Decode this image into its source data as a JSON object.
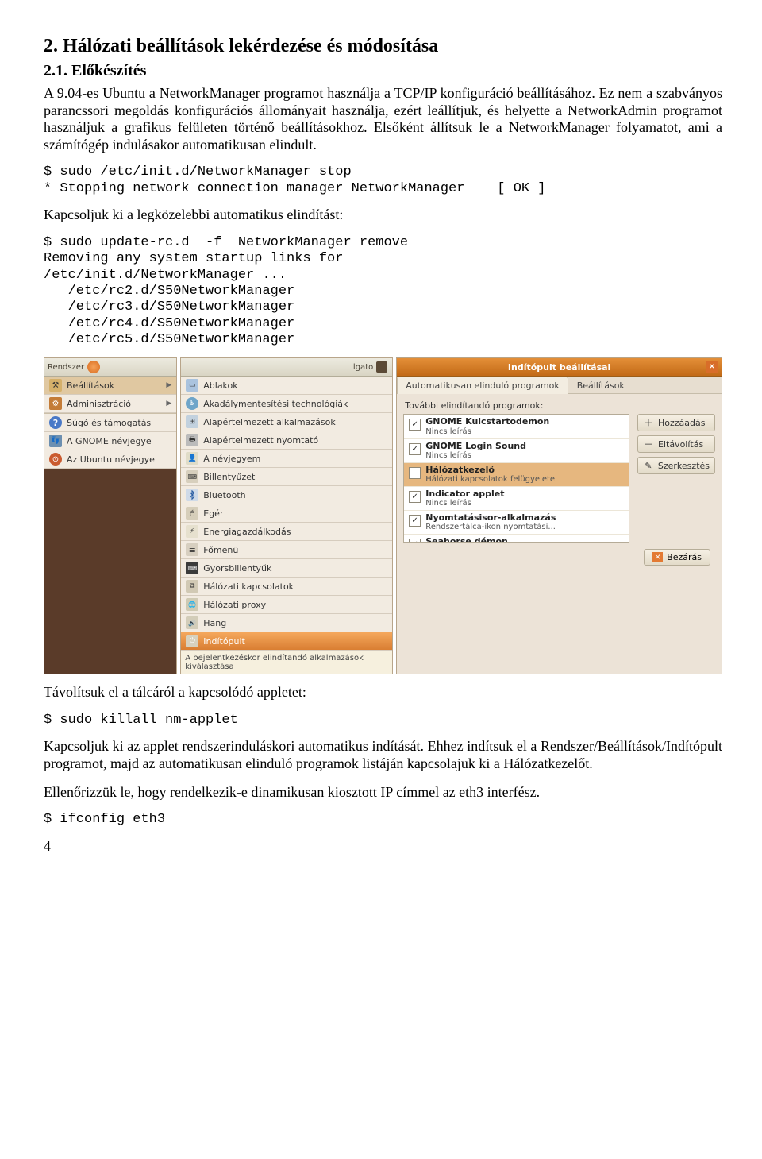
{
  "heading1": "2.    Hálózati beállítások lekérdezése és módosítása",
  "heading2": "2.1. Előkészítés",
  "para1": "A 9.04-es Ubuntu a NetworkManager programot használja a TCP/IP konfiguráció beállításához. Ez nem a szabványos parancssori megoldás konfigurációs állományait használja, ezért leállítjuk, és helyette a NetworkAdmin programot használjuk a grafikus felületen történő beállításokhoz. Elsőként állítsuk le a NetworkManager folyamatot, ami a számítógép indulásakor automatikusan elindult.",
  "code1": "$ sudo /etc/init.d/NetworkManager stop\n* Stopping network connection manager NetworkManager    [ OK ]",
  "para2": "Kapcsoljuk ki a legközelebbi automatikus elindítást:",
  "code2": "$ sudo update-rc.d  -f  NetworkManager remove\nRemoving any system startup links for\n/etc/init.d/NetworkManager ...\n   /etc/rc2.d/S50NetworkManager\n   /etc/rc3.d/S50NetworkManager\n   /etc/rc4.d/S50NetworkManager\n   /etc/rc5.d/S50NetworkManager",
  "leftPanel": {
    "title": "Rendszer",
    "items": [
      {
        "label": "Beállítások",
        "icon": "ic-tool"
      },
      {
        "label": "Adminisztráció",
        "icon": "ic-admin"
      },
      {
        "label": "Súgó és támogatás",
        "icon": "ic-help"
      },
      {
        "label": "A GNOME névjegye",
        "icon": "ic-gnome"
      },
      {
        "label": "Az Ubuntu névjegye",
        "icon": "ic-ubuntu"
      }
    ]
  },
  "midPanel": {
    "items": [
      {
        "label": "Ablakok",
        "icon": "ic-win"
      },
      {
        "label": "Akadálymentesítési technológiák",
        "icon": "ic-acc"
      },
      {
        "label": "Alapértelmezett alkalmazások",
        "icon": "ic-apps"
      },
      {
        "label": "Alapértelmezett nyomtató",
        "icon": "ic-print"
      },
      {
        "label": "A névjegyem",
        "icon": "ic-id"
      },
      {
        "label": "Billentyűzet",
        "icon": "ic-key"
      },
      {
        "label": "Bluetooth",
        "icon": "ic-bt"
      },
      {
        "label": "Egér",
        "icon": "ic-mouse"
      },
      {
        "label": "Energiagazdálkodás",
        "icon": "ic-energy"
      },
      {
        "label": "Főmenü",
        "icon": "ic-menu"
      },
      {
        "label": "Gyorsbillentyűk",
        "icon": "ic-short"
      },
      {
        "label": "Hálózati kapcsolatok",
        "icon": "ic-net"
      },
      {
        "label": "Hálózati proxy",
        "icon": "ic-proxy"
      },
      {
        "label": "Hang",
        "icon": "ic-sound"
      },
      {
        "label": "Indítópult",
        "icon": "ic-start"
      }
    ],
    "tooltip": "A bejelentkezéskor elindítandó alkalmazások kiválasztása",
    "taskbar": "ilgato"
  },
  "rightPanel": {
    "title": "Indítópult beállításai",
    "tabs": [
      "Automatikusan elinduló programok",
      "Beállítások"
    ],
    "sectionLabel": "További elindítandó programok:",
    "rows": [
      {
        "checked": true,
        "title": "GNOME Kulcstartodemon",
        "sub": "Nincs leírás"
      },
      {
        "checked": true,
        "title": "GNOME Login Sound",
        "sub": "Nincs leírás"
      },
      {
        "checked": false,
        "title": "Hálózatkezelő",
        "sub": "Hálózati kapcsolatok felügyelete",
        "sel": true
      },
      {
        "checked": true,
        "title": "Indicator applet",
        "sub": "Nincs leírás"
      },
      {
        "checked": true,
        "title": "Nyomtatásisor-alkalmazás",
        "sub": "Rendszertálca-ikon nyomtatási..."
      },
      {
        "checked": true,
        "title": "Seahorse démon",
        "sub": ""
      }
    ],
    "buttons": {
      "add": "Hozzáadás",
      "remove": "Eltávolítás",
      "edit": "Szerkesztés"
    },
    "close": "Bezárás"
  },
  "para3": "Távolítsuk el a tálcáról a kapcsolódó appletet:",
  "code3": "$ sudo killall nm-applet",
  "para4": "Kapcsoljuk ki az applet rendszerinduláskori automatikus indítását. Ehhez indítsuk el a Rendszer/Beállítások/Indítópult programot, majd az automatikusan elinduló programok listáján kapcsolajuk ki a Hálózatkezelőt.",
  "para5": "Ellenőrizzük le, hogy rendelkezik-e dinamikusan kiosztott IP címmel az eth3 interfész.",
  "code4": "$ ifconfig eth3",
  "pageNum": "4"
}
